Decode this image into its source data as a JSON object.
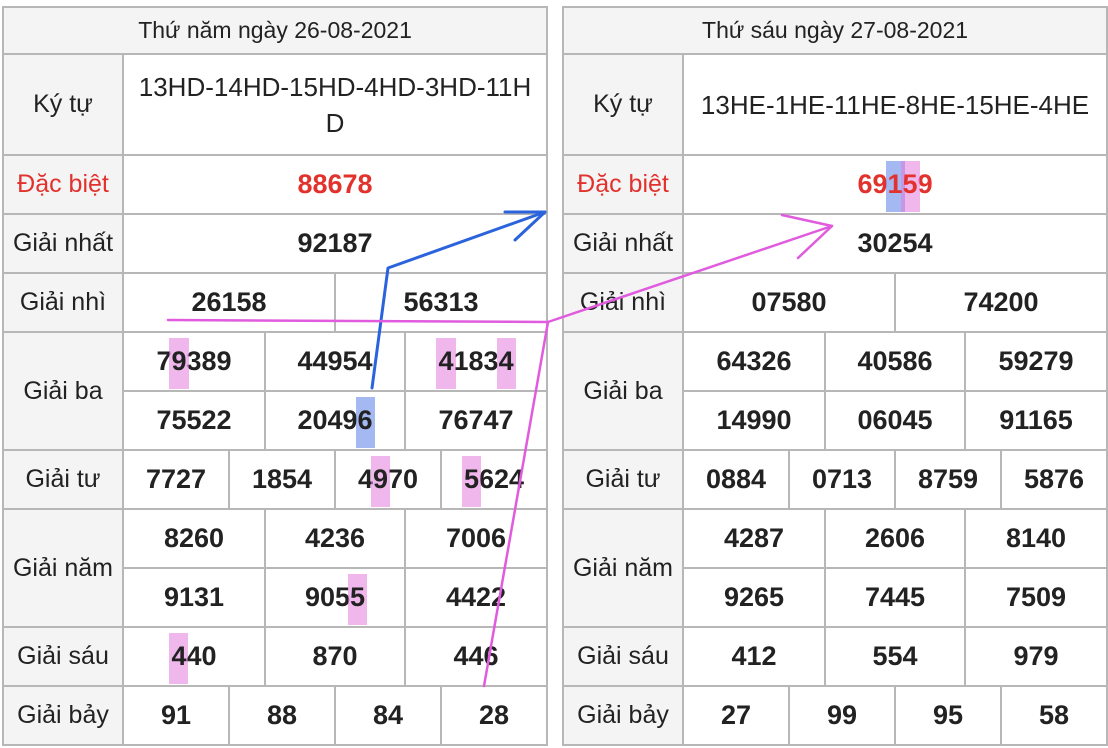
{
  "left": {
    "date": "Thứ năm ngày 26-08-2021",
    "labels": {
      "symbols": "Ký tự",
      "special": "Đặc biệt",
      "first": "Giải nhất",
      "second": "Giải nhì",
      "third": "Giải ba",
      "fourth": "Giải tư",
      "fifth": "Giải năm",
      "sixth": "Giải sáu",
      "seventh": "Giải bảy"
    },
    "symbols": "13HD-14HD-15HD-4HD-3HD-11HD",
    "special": "88678",
    "first": "92187",
    "second": [
      "26158",
      "56313"
    ],
    "third": [
      "79389",
      "44954",
      "41834",
      "75522",
      "20496",
      "76747"
    ],
    "fourth": [
      "7727",
      "1854",
      "4970",
      "5624"
    ],
    "fifth": [
      "8260",
      "4236",
      "7006",
      "9131",
      "9055",
      "4422"
    ],
    "sixth": [
      "440",
      "870",
      "446"
    ],
    "seventh": [
      "91",
      "88",
      "84",
      "28"
    ]
  },
  "right": {
    "date": "Thứ sáu ngày 27-08-2021",
    "labels": {
      "symbols": "Ký tự",
      "special": "Đặc biệt",
      "first": "Giải nhất",
      "second": "Giải nhì",
      "third": "Giải ba",
      "fourth": "Giải tư",
      "fifth": "Giải năm",
      "sixth": "Giải sáu",
      "seventh": "Giải bảy"
    },
    "symbols": "13HE-1HE-11HE-8HE-15HE-4HE",
    "special": "69159",
    "first": "30254",
    "second": [
      "07580",
      "74200"
    ],
    "third": [
      "64326",
      "40586",
      "59279",
      "14990",
      "06045",
      "91165"
    ],
    "fourth": [
      "0884",
      "0713",
      "8759",
      "5876"
    ],
    "fifth": [
      "4287",
      "2606",
      "8140",
      "9265",
      "7445",
      "7509"
    ],
    "sixth": [
      "412",
      "554",
      "979"
    ],
    "seventh": [
      "27",
      "99",
      "95",
      "58"
    ]
  },
  "colors": {
    "special_text": "#e2322d",
    "highlight_pink": "#e37bdc",
    "highlight_blue": "#5a7fe6",
    "arrow_blue": "#2a63dc",
    "arrow_pink": "#e05bdd"
  },
  "highlights": [
    {
      "cell": "left.third.0",
      "digit": "9",
      "color": "pink"
    },
    {
      "cell": "left.third.2",
      "digit": "4 (2nd) and 4 (last)",
      "color": "pink"
    },
    {
      "cell": "left.third.4",
      "digit": "6",
      "color": "blue"
    },
    {
      "cell": "left.fourth.2",
      "digit": "9",
      "color": "pink"
    },
    {
      "cell": "left.fourth.3",
      "digit": "5",
      "color": "pink"
    },
    {
      "cell": "left.fifth.4",
      "digit": "5",
      "color": "pink"
    },
    {
      "cell": "left.sixth.0",
      "digit": "4",
      "color": "pink"
    },
    {
      "cell": "right.special",
      "digit": "1 blue, 5 pink",
      "color": "mixed"
    }
  ]
}
